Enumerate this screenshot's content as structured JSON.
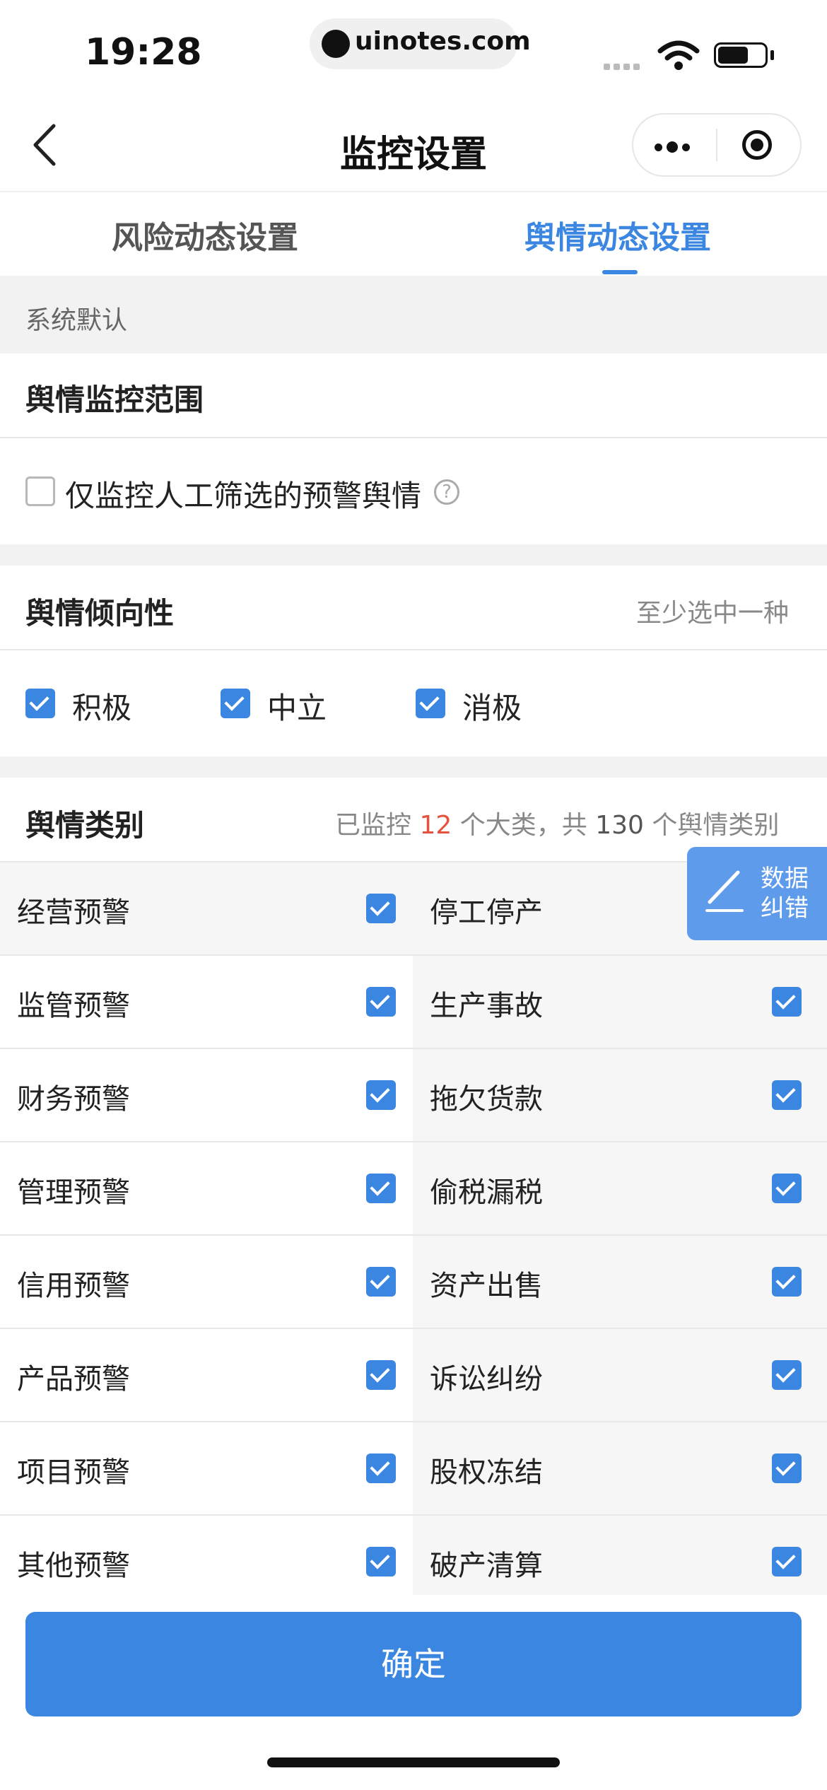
{
  "status_bar": {
    "time": "19:28",
    "url": "uinotes.com"
  },
  "nav": {
    "title": "监控设置"
  },
  "tabs": [
    {
      "label": "风险动态设置",
      "active": false
    },
    {
      "label": "舆情动态设置",
      "active": true
    }
  ],
  "default_label": "系统默认",
  "scope": {
    "title": "舆情监控范围",
    "option_label": "仅监控人工筛选的预警舆情",
    "option_checked": false,
    "help_icon": "question-circle-icon",
    "help_glyph": "?"
  },
  "tendency": {
    "title": "舆情倾向性",
    "hint": "至少选中一种",
    "options": [
      {
        "label": "积极",
        "checked": true
      },
      {
        "label": "中立",
        "checked": true
      },
      {
        "label": "消极",
        "checked": true
      }
    ]
  },
  "category": {
    "title": "舆情类别",
    "count_prefix": "已监控",
    "major_count": "12",
    "count_middle": "个大类，共",
    "total_count": "130",
    "count_suffix": "个舆情类别",
    "rows": [
      {
        "left": "经营预警",
        "right": "停工停产"
      },
      {
        "left": "监管预警",
        "right": "生产事故"
      },
      {
        "left": "财务预警",
        "right": "拖欠货款"
      },
      {
        "left": "管理预警",
        "right": "偷税漏税"
      },
      {
        "left": "信用预警",
        "right": "资产出售"
      },
      {
        "left": "产品预警",
        "right": "诉讼纠纷"
      },
      {
        "left": "项目预警",
        "right": "股权冻结"
      },
      {
        "left": "其他预警",
        "right": "破产清算"
      }
    ]
  },
  "float_button": {
    "label_line1": "数据",
    "label_line2": "纠错"
  },
  "confirm_label": "确定",
  "colors": {
    "accent": "#3b86e0",
    "highlight": "#e5533e",
    "section_bg": "#f2f2f2"
  }
}
